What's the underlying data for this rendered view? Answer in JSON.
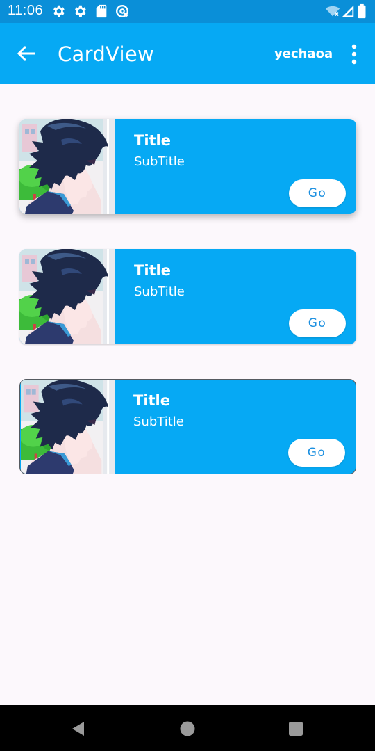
{
  "status_bar": {
    "time": "11:06",
    "icons": [
      "settings-gear-icon",
      "settings-gear-icon",
      "sd-card-icon",
      "data-saver-icon",
      "wifi-off-icon",
      "signal-icon",
      "battery-icon"
    ]
  },
  "app_bar": {
    "title": "CardView",
    "action_label": "yechaoa",
    "back_icon": "arrow-back-icon",
    "overflow_icon": "more-vert-icon"
  },
  "cards": [
    {
      "title": "Title",
      "subtitle": "SubTitle",
      "button_label": "Go",
      "style": "elevated"
    },
    {
      "title": "Title",
      "subtitle": "SubTitle",
      "button_label": "Go",
      "style": "flat"
    },
    {
      "title": "Title",
      "subtitle": "SubTitle",
      "button_label": "Go",
      "style": "outlined"
    }
  ],
  "nav_bar": {
    "icons": [
      "nav-back-icon",
      "nav-home-icon",
      "nav-recents-icon"
    ]
  },
  "colors": {
    "status_bar": "#0a8fd8",
    "primary": "#06a9f4",
    "background": "#fcf8fc",
    "button_text": "#1a8fe0"
  }
}
